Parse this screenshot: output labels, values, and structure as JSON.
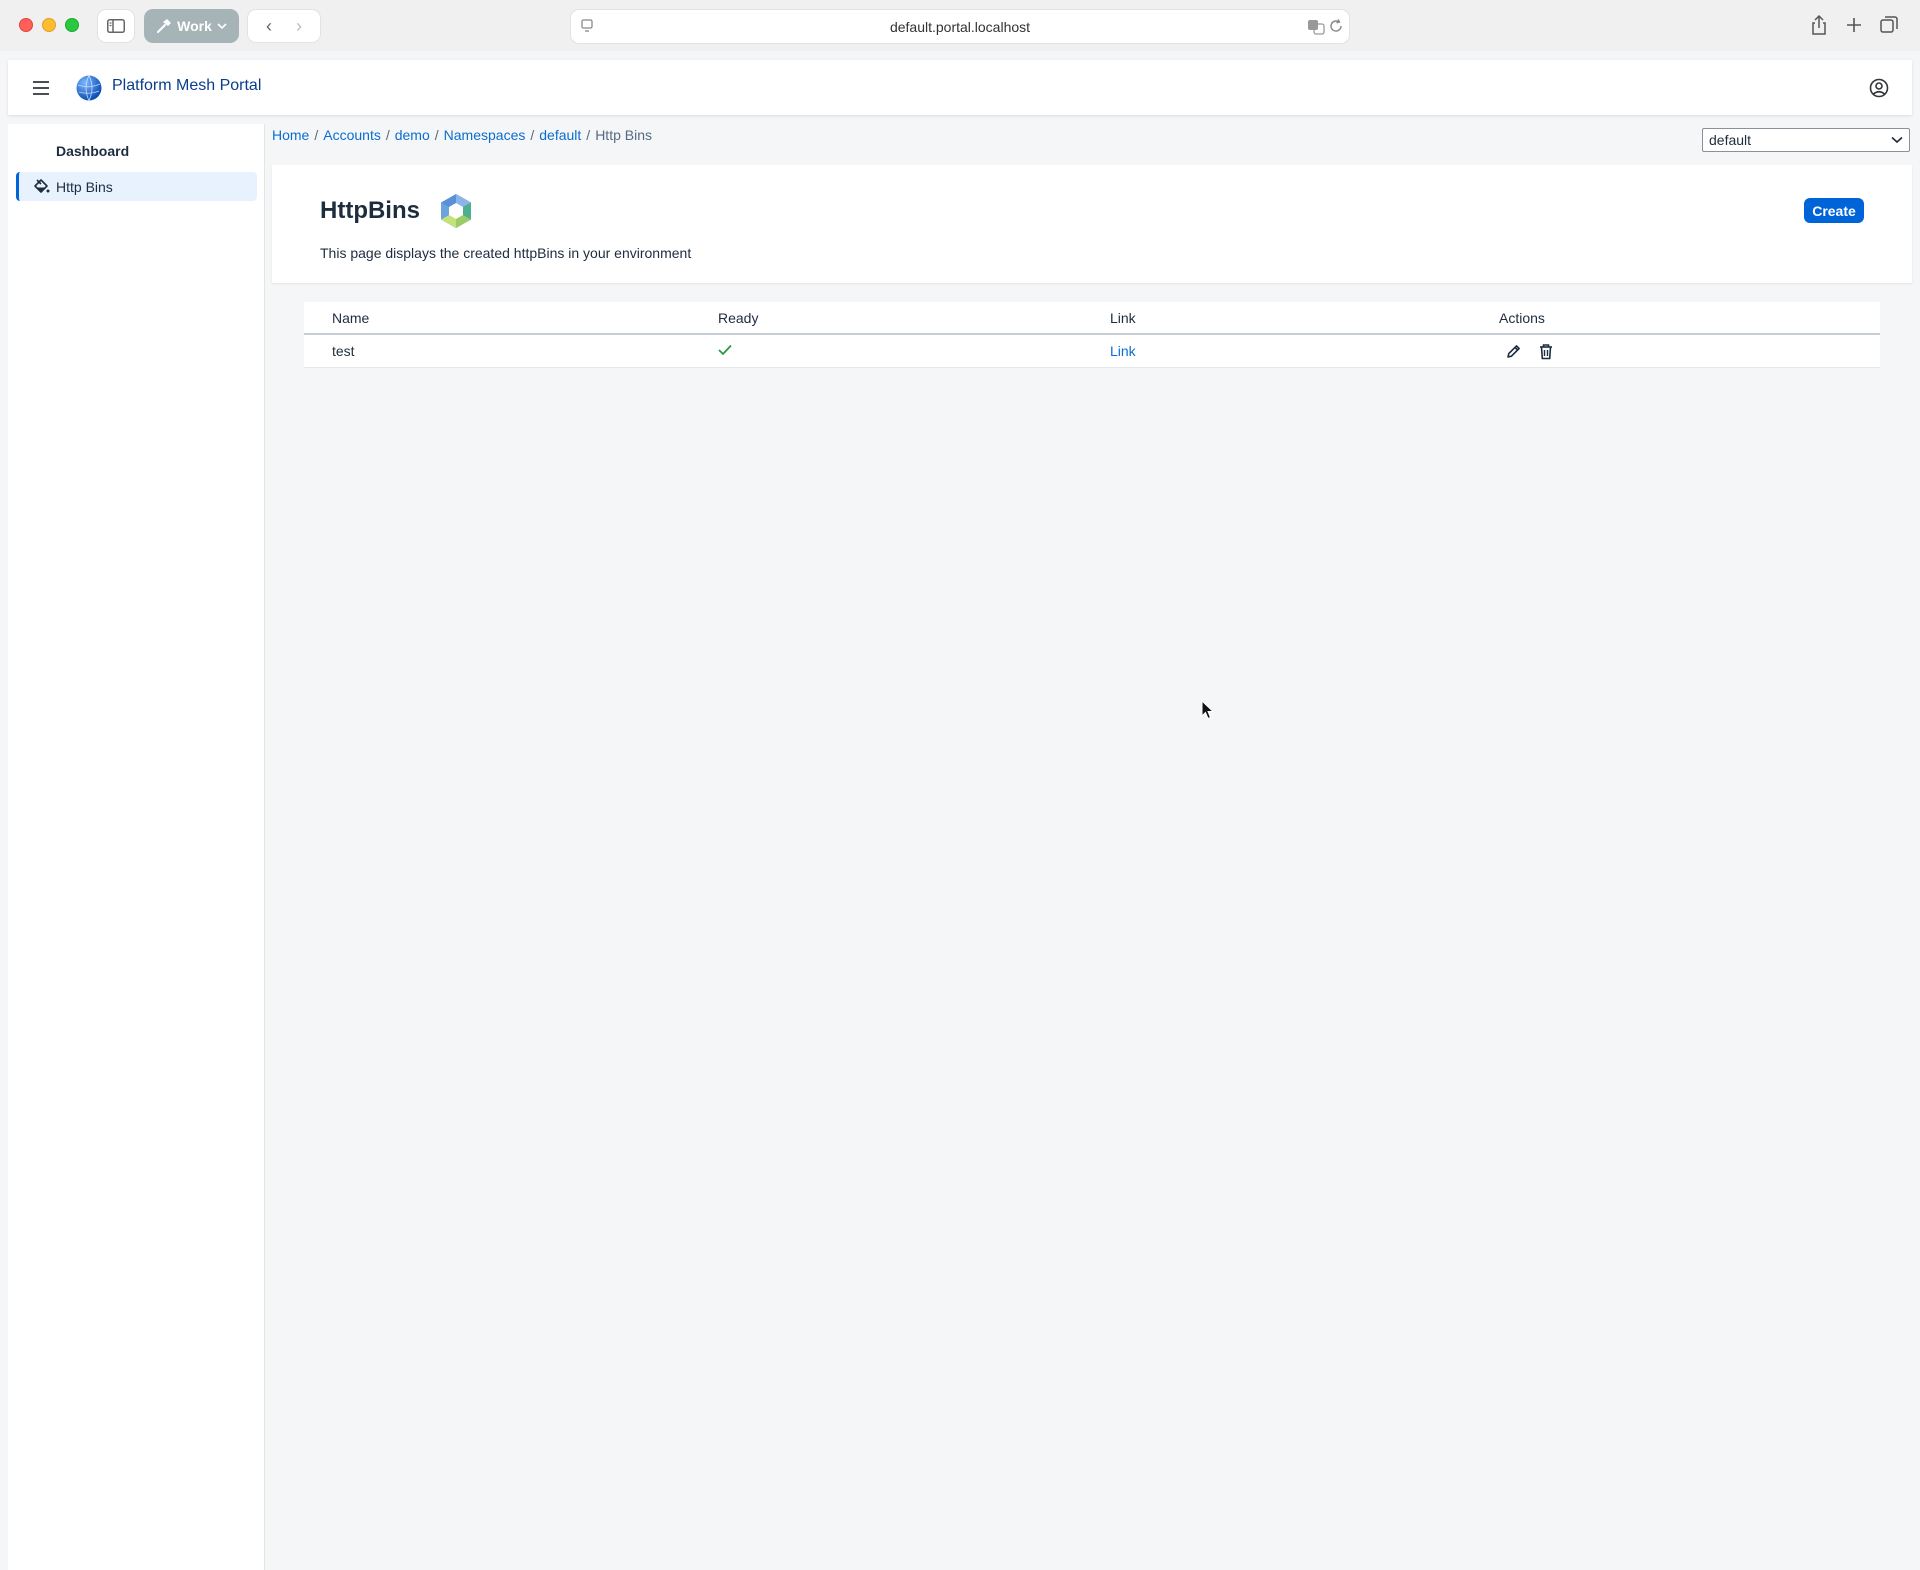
{
  "browser": {
    "profile_label": "Work",
    "url": "default.portal.localhost"
  },
  "app": {
    "title": "Platform Mesh Portal",
    "colors": {
      "accent": "#0064d9",
      "link": "#0a6ed1",
      "success": "#2b9a3c"
    }
  },
  "sidebar": {
    "items": [
      {
        "label": "Dashboard",
        "active": false
      },
      {
        "label": "Http Bins",
        "active": true,
        "icon": "paint-bucket-icon"
      }
    ]
  },
  "breadcrumb": {
    "items": [
      "Home",
      "Accounts",
      "demo",
      "Namespaces",
      "default"
    ],
    "current": "Http Bins"
  },
  "namespace_select": {
    "value": "default"
  },
  "page": {
    "title": "HttpBins",
    "description": "This page displays the created httpBins in your environment",
    "create_label": "Create"
  },
  "table": {
    "columns": [
      "Name",
      "Ready",
      "Link",
      "Actions"
    ],
    "rows": [
      {
        "name": "test",
        "ready": true,
        "link": "Link"
      }
    ]
  }
}
